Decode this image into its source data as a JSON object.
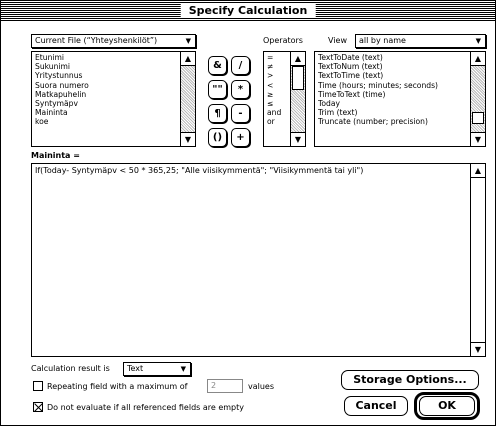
{
  "dialog": {
    "title": "Specify Calculation"
  },
  "fields_popup": {
    "selected": "Current File (“Yhteyshenkilöt”)"
  },
  "fields": [
    "Etunimi",
    "Sukunimi",
    "Yritystunnus",
    "Suora numero",
    "Matkapuhelin",
    "Syntymäpv",
    "Maininta",
    "koe"
  ],
  "operator_buttons": [
    "&",
    "/",
    "\"\"",
    "*",
    "¶",
    "-",
    "()",
    "+"
  ],
  "operators_label": "Operators",
  "operators": [
    "=",
    "≠",
    ">",
    "<",
    "≥",
    "≤",
    "and",
    "or"
  ],
  "view": {
    "label": "View",
    "selected": "all by name"
  },
  "functions": [
    "TextToDate (text)",
    "TextToNum (text)",
    "TextToTime (text)",
    "Time (hours; minutes; seconds)",
    "TimeToText (time)",
    "Today",
    "Trim (text)",
    "Truncate (number; precision)"
  ],
  "formula": {
    "label": "Maininta =",
    "text": "If(Today- Syntymäpv < 50 * 365,25; \"Alle viisikymmentä\"; \"Viisikymmentä tai yli\")"
  },
  "result": {
    "label": "Calculation result is",
    "selected": "Text"
  },
  "repeating": {
    "label_before": "Repeating field with a maximum of",
    "value": "2",
    "label_after": "values",
    "checked": false
  },
  "do_not_evaluate": {
    "label": "Do not evaluate if all referenced fields are empty",
    "checked": true
  },
  "buttons": {
    "storage": "Storage Options...",
    "cancel": "Cancel",
    "ok": "OK"
  },
  "icons": {
    "scroll_up": "▲",
    "scroll_down": "▼",
    "popup_arrow": "▼"
  }
}
